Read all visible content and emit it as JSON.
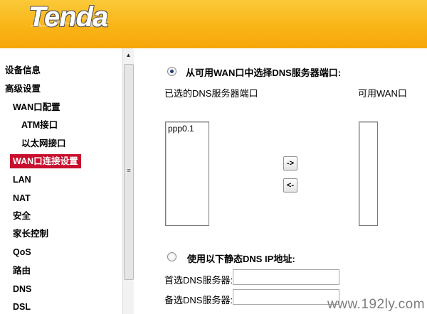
{
  "header": {
    "logo_text": "Tenda"
  },
  "sidebar": {
    "items": [
      {
        "label": "设备信息"
      },
      {
        "label": "高级设置"
      },
      {
        "label": "WAN口配置"
      },
      {
        "label": "ATM接口"
      },
      {
        "label": "以太网接口"
      },
      {
        "label": "WAN口连接设置",
        "active": true
      },
      {
        "label": "LAN"
      },
      {
        "label": "NAT"
      },
      {
        "label": "安全"
      },
      {
        "label": "家长控制"
      },
      {
        "label": "QoS"
      },
      {
        "label": "路由"
      },
      {
        "label": "DNS"
      },
      {
        "label": "DSL"
      }
    ]
  },
  "scrollbar": {
    "up_arrow": "▲",
    "grip": "≡"
  },
  "dns_select": {
    "radio_label": "从可用WAN口中选择DNS服务器端口:",
    "selected": true,
    "selected_list_label": "已选的DNS服务器端口",
    "available_list_label": "可用WAN口",
    "selected_items": [
      "ppp0.1"
    ],
    "available_items": [],
    "move_right_label": "->",
    "move_left_label": "<-"
  },
  "static_dns": {
    "radio_label": "使用以下静态DNS IP地址:",
    "selected": false,
    "primary_label": "首选DNS服务器:",
    "primary_value": "",
    "secondary_label": "备选DNS服务器:",
    "secondary_value": ""
  },
  "watermark": "www.192ly.com"
}
